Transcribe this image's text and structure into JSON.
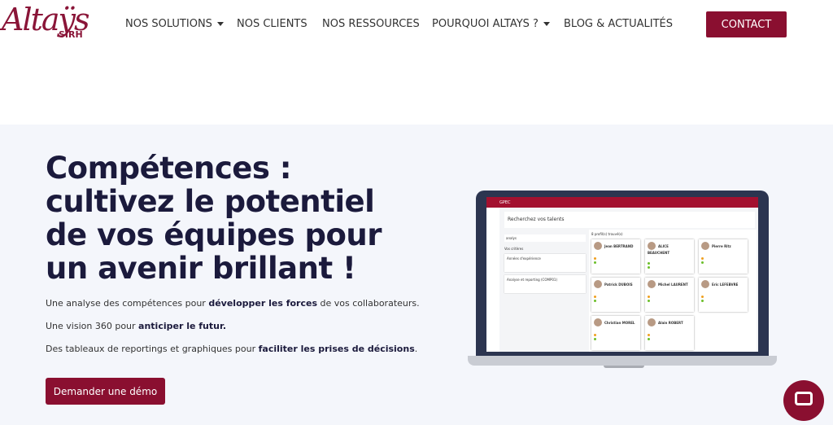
{
  "brand": {
    "name": "Altaÿs",
    "sub": "SIRH",
    "color": "#8a1538"
  },
  "nav": {
    "items": [
      {
        "label": "NOS SOLUTIONS",
        "dropdown": true
      },
      {
        "label": "NOS CLIENTS"
      },
      {
        "label": "NOS RESSOURCES"
      },
      {
        "label": "POURQUOI ALTAYS ?",
        "dropdown": true
      },
      {
        "label": "BLOG & ACTUALITÉS"
      }
    ],
    "contact": "CONTACT"
  },
  "hero": {
    "title": "Compétences : cultivez le potentiel de vos équipes pour un avenir brillant !",
    "lines": [
      {
        "pre": "Une analyse des compétences pour ",
        "bold": "développer les forces",
        "post": " de vos collaborateurs."
      },
      {
        "pre": "Une vision 360 pour ",
        "bold": "anticiper le futur.",
        "post": ""
      },
      {
        "pre": "Des tableaux de reportings et graphiques pour ",
        "bold": "faciliter les prises de décisions",
        "post": "."
      }
    ],
    "cta": "Demander une démo"
  },
  "app": {
    "name": "GPEC",
    "title": "Recherchez vos talents",
    "search": "analys",
    "criteria_label": "Vos critères",
    "filter1": "Années d'expérience",
    "filter2": "Analyse et reporting (COMP01)",
    "results": "8 profil(s) trouvé(s)",
    "profiles": [
      {
        "name": "Jean BERTRAND",
        "c": "#f0a020"
      },
      {
        "name": "ALICE BEAUCHENT",
        "c": "#6cbf2a"
      },
      {
        "name": "Pierre Ritz",
        "c": "#f0a020"
      },
      {
        "name": "Patrick DUBOIS",
        "c": "#f0a020"
      },
      {
        "name": "Michel LAURENT",
        "c": "#f0a020"
      },
      {
        "name": "Eric LEFEBVRE",
        "c": "#f0a020"
      },
      {
        "name": "Christian MOREL",
        "c": "#f0a020"
      },
      {
        "name": "Alain ROBERT",
        "c": "#f0a020"
      }
    ]
  },
  "accent": "#8a0f30"
}
